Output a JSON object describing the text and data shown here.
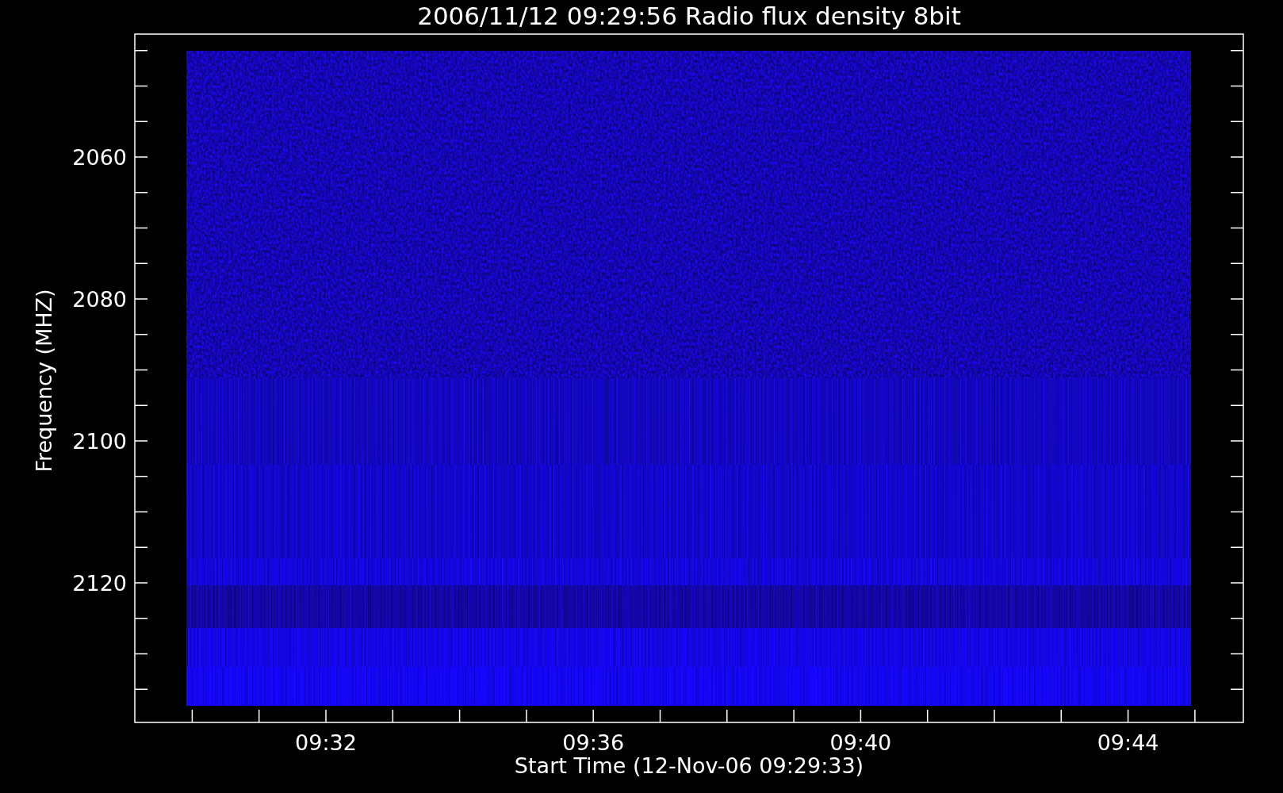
{
  "title": "2006/11/12 09:29:56 Radio flux density 8bit",
  "y_axis": {
    "label": "Frequency (MHZ)",
    "tick_labels": [
      "2060",
      "2080",
      "2100",
      "2120"
    ]
  },
  "x_axis": {
    "label": "Start Time (12-Nov-06 09:29:33)",
    "tick_labels": [
      "09:32",
      "09:36",
      "09:40",
      "09:44"
    ]
  }
}
